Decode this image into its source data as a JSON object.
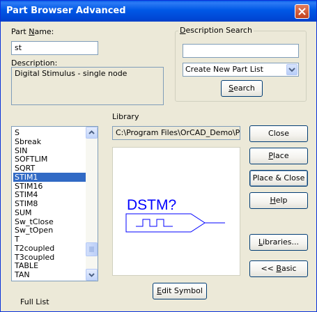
{
  "window": {
    "title": "Part Browser Advanced"
  },
  "part_name": {
    "label_pre": "Part ",
    "label_u": "N",
    "label_post": "ame:",
    "value": "st"
  },
  "description": {
    "label": "Description:",
    "value": "Digital Stimulus - single node"
  },
  "desc_search": {
    "title_u": "D",
    "title_post": "escription Search",
    "query": "",
    "combo_value": "Create New Part List",
    "search_u": "S",
    "search_post": "earch"
  },
  "library": {
    "label": "Library",
    "path": "C:\\Program Files\\OrCAD_Demo\\PSpi"
  },
  "parts_list": {
    "items": [
      "S",
      "Sbreak",
      "SIN",
      "SOFTLIM",
      "SQRT",
      "STIM1",
      "STIM16",
      "STIM4",
      "STIM8",
      "SUM",
      "Sw_tClose",
      "Sw_tOpen",
      "T",
      "T2coupled",
      "T3coupled",
      "TABLE",
      "TAN"
    ],
    "selected": "STIM1"
  },
  "symbol": {
    "text": "DSTM?"
  },
  "buttons": {
    "close": "Close",
    "place_u": "P",
    "place_post": "lace",
    "place_close": "Place & Close",
    "help_u": "H",
    "help_post": "elp",
    "libraries_u": "L",
    "libraries_post": "ibraries...",
    "basic_pre": "<< ",
    "basic_u": "B",
    "basic_post": "asic",
    "edit_u": "E",
    "edit_post": "dit Symbol"
  },
  "footer": {
    "full_list": "Full List"
  },
  "colors": {
    "titlebar": "#0054E3",
    "selection": "#316AC5",
    "symbol": "#0000FF",
    "face": "#ECE9D8"
  }
}
